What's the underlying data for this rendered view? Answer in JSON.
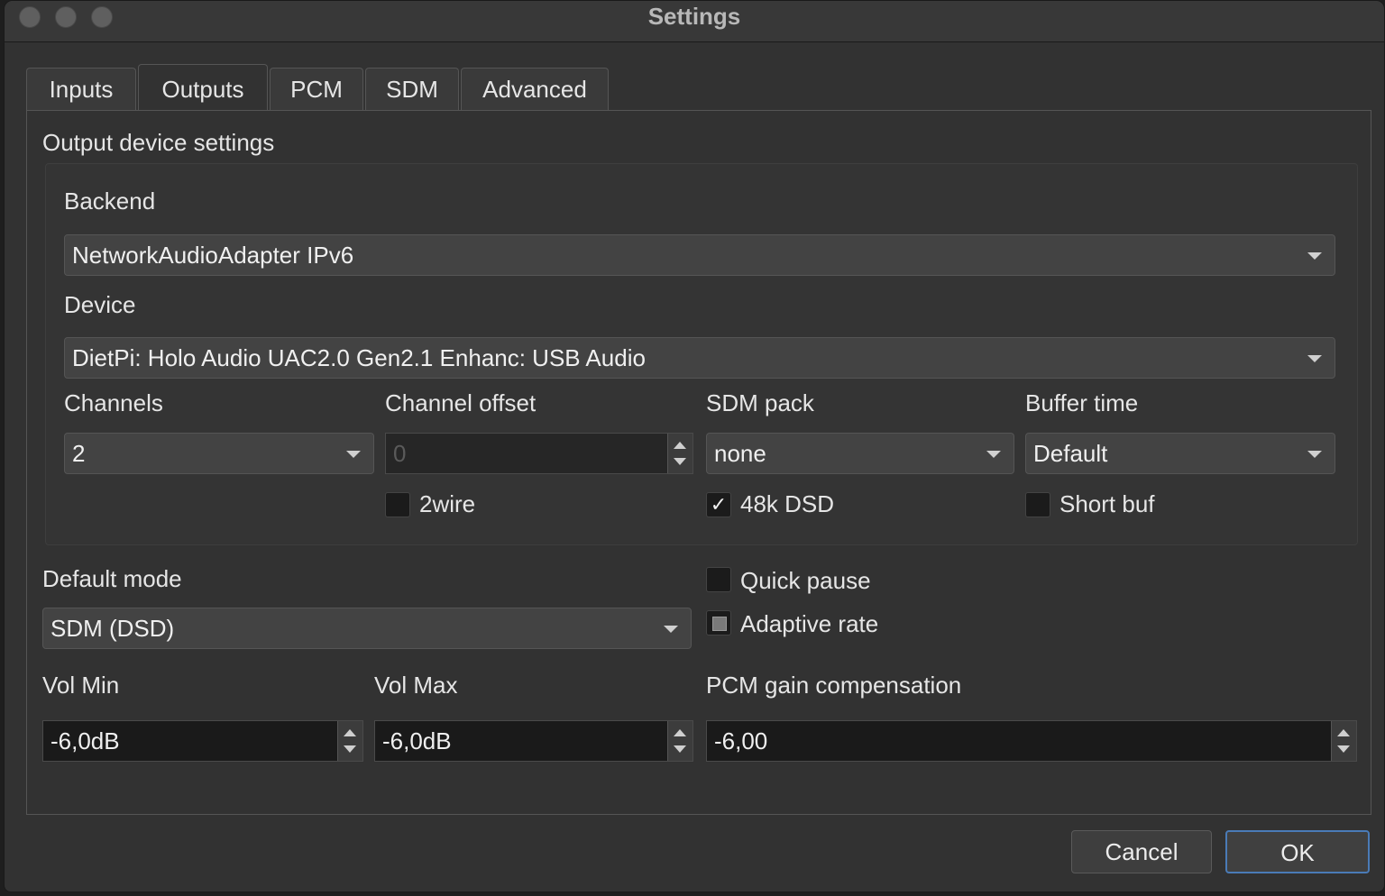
{
  "window": {
    "title": "Settings"
  },
  "tabs": [
    "Inputs",
    "Outputs",
    "PCM",
    "SDM",
    "Advanced"
  ],
  "output_device": {
    "section_title": "Output device settings",
    "backend_label": "Backend",
    "backend_value": "NetworkAudioAdapter IPv6",
    "device_label": "Device",
    "device_value": "DietPi: Holo Audio UAC2.0 Gen2.1 Enhanc: USB Audio",
    "channels_label": "Channels",
    "channels_value": "2",
    "channel_offset_label": "Channel offset",
    "channel_offset_value": "0",
    "sdm_pack_label": "SDM pack",
    "sdm_pack_value": "none",
    "buffer_time_label": "Buffer time",
    "buffer_time_value": "Default",
    "twowire_label": "2wire",
    "twowire_checked": false,
    "dsd48k_label": "48k DSD",
    "dsd48k_checked": true,
    "dsd48k_mark": "✓",
    "short_buf_label": "Short buf",
    "short_buf_checked": false
  },
  "default_mode": {
    "label": "Default mode",
    "value": "SDM (DSD)"
  },
  "quick_pause": {
    "label": "Quick pause",
    "checked": false
  },
  "adaptive_rate": {
    "label": "Adaptive rate",
    "state": "partial"
  },
  "vol_min": {
    "label": "Vol Min",
    "value": "-6,0dB"
  },
  "vol_max": {
    "label": "Vol Max",
    "value": "-6,0dB"
  },
  "pcm_gain": {
    "label": "PCM gain compensation",
    "value": "-6,00"
  },
  "buttons": {
    "cancel": "Cancel",
    "ok": "OK"
  },
  "colors": {
    "accent": "#4a7bb7",
    "background": "#323232",
    "field": "#1a1a1a"
  }
}
